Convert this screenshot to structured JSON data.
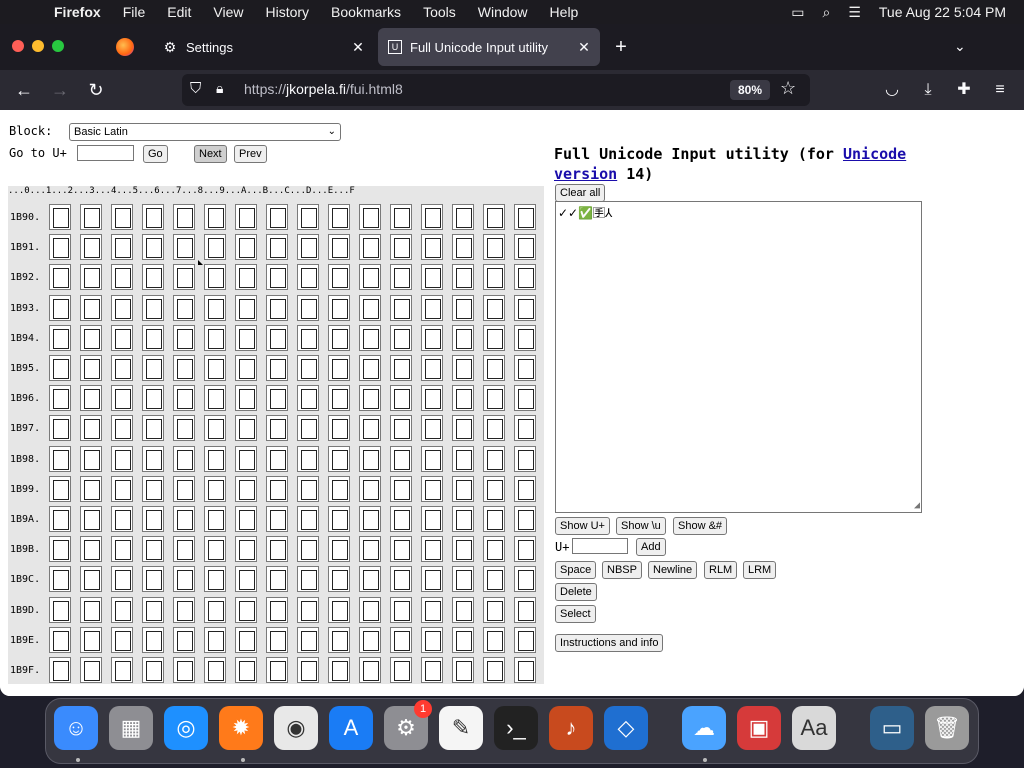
{
  "menubar": {
    "app": "Firefox",
    "items": [
      "File",
      "Edit",
      "View",
      "History",
      "Bookmarks",
      "Tools",
      "Window",
      "Help"
    ],
    "datetime": "Tue Aug 22  5:04 PM"
  },
  "tabs": [
    {
      "label": "Settings",
      "icon": "gear-icon"
    },
    {
      "label": "Full Unicode Input utility",
      "icon": "fui-favicon"
    }
  ],
  "urlbar": {
    "url_prefix": "https://",
    "url_host": "jkorpela.fi",
    "url_path": "/fui.html8",
    "zoom": "80%"
  },
  "page": {
    "block_label": "Block:",
    "block_value": "Basic Latin",
    "goto_label": "Go to U+",
    "go_button": "Go",
    "next_button": "Next",
    "prev_button": "Prev",
    "column_header": "...0...1...2...3...4...5...6...7...8...9...A...B...C...D...E...F",
    "rows": [
      "1B90.",
      "1B91.",
      "1B92.",
      "1B93.",
      "1B94.",
      "1B95.",
      "1B96.",
      "1B97.",
      "1B98.",
      "1B99.",
      "1B9A.",
      "1B9B.",
      "1B9C.",
      "1B9D.",
      "1B9E.",
      "1B9F."
    ],
    "title_prefix": "Full Unicode Input utility (for ",
    "title_link": "Unicode version",
    "title_suffix": " 14)",
    "clear_all": "Clear all",
    "text_content": "✓✓✅🈐⅄",
    "show_uplus": "Show U+",
    "show_backslash_u": "Show \\u",
    "show_entity": "Show &#",
    "uplus_label": "U+",
    "add_button": "Add",
    "space_button": "Space",
    "nbsp_button": "NBSP",
    "newline_button": "Newline",
    "rlm_button": "RLM",
    "lrm_button": "LRM",
    "delete_button": "Delete",
    "select_button": "Select",
    "instructions_button": "Instructions and info"
  },
  "dock": {
    "apps": [
      "Finder",
      "Launchpad",
      "Safari",
      "Firefox",
      "Chrome",
      "App Store",
      "System Settings",
      "TextEdit",
      "Terminal",
      "GarageBand",
      "VS Code",
      "Weather",
      "Photo Booth",
      "Dictionary",
      "Screenshot",
      "Trash"
    ],
    "badge": "1"
  }
}
